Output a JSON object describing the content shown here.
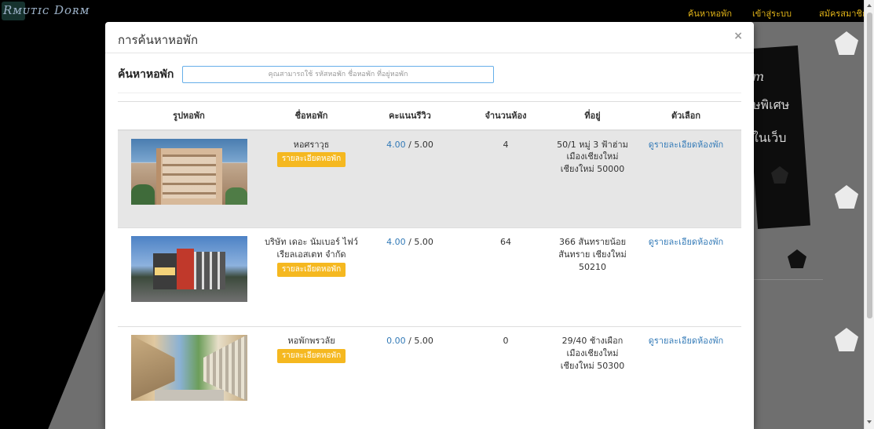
{
  "background": {
    "logo": "Rᴍᴜᴛɪᴄ Dᴏʀᴍ",
    "nav": [
      "ค้นหาหอพัก",
      "เข้าสู่ระบบ",
      "สมัครสมาชิก"
    ],
    "side_text": [
      "m",
      "ษพิเศษ",
      "ในเว็บ"
    ]
  },
  "modal": {
    "title": "การค้นหาหอพัก",
    "close": "×",
    "search_label": "ค้นหาหอพัก",
    "search_placeholder": "คุณสามารถใช้ รหัสหอพัก ชื่อหอพัก ที่อยู่หอพัก",
    "columns": [
      "รูปหอพัก",
      "ชื่อหอพัก",
      "คะแนนรีวิว",
      "จำนวนห้อง",
      "ที่อยู่",
      "ตัวเลือก"
    ],
    "rows": [
      {
        "name": "หอศราวุธ",
        "detail_button": "รายละเอียดหอพัก",
        "score": "4.00",
        "score_max": " / 5.00",
        "rooms": "4",
        "address": "50/1 หมู่ 3 ฟ้าฮ่าม เมืองเชียงใหม่ เชียงใหม่ 50000",
        "room_link": "ดูรายละเอียดห้องพัก"
      },
      {
        "name": "บริษัท เดอะ นัมเบอร์ ไฟว์ เรียลเอสเตท จำกัด",
        "detail_button": "รายละเอียดหอพัก",
        "score": "4.00",
        "score_max": " / 5.00",
        "rooms": "64",
        "address": "366 สันทรายน้อย สันทราย เชียงใหม่ 50210",
        "room_link": "ดูรายละเอียดห้องพัก"
      },
      {
        "name": "หอพักพรวลัย",
        "detail_button": "รายละเอียดหอพัก",
        "score": "0.00",
        "score_max": " / 5.00",
        "rooms": "0",
        "address": "29/40 ช้างเผือก เมืองเชียงใหม่ เชียงใหม่ 50300",
        "room_link": "ดูรายละเอียดห้องพัก"
      }
    ]
  },
  "colors": {
    "accent_button": "#f5b820",
    "link": "#337ab7",
    "nav_text": "#e2b418",
    "row_highlight": "#e6e6e6"
  }
}
